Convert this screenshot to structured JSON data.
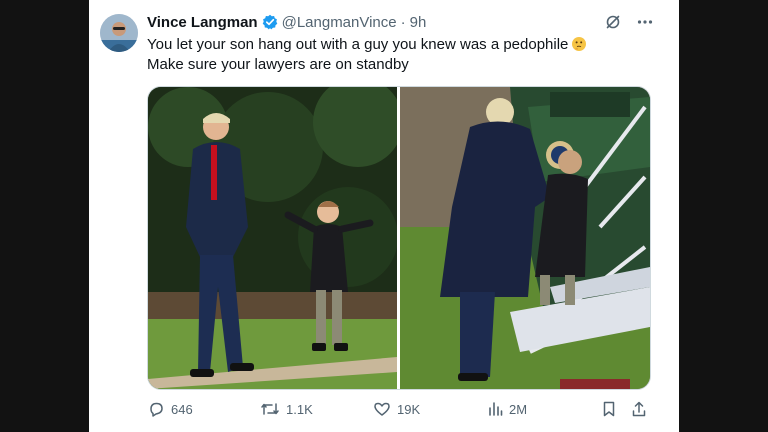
{
  "tweet": {
    "display_name": "Vince Langman",
    "handle": "@LangmanVince",
    "separator": "·",
    "time": "9h",
    "text_line1": "You let your son hang out with a guy you knew was a pedophile",
    "text_line2": "Make sure your lawyers are on standby",
    "emoji": "thinking-face"
  },
  "header_icons": [
    "grok-icon",
    "more-icon"
  ],
  "media": [
    {
      "alt_name": "photo-left",
      "description_icon": "photo"
    },
    {
      "alt_name": "photo-right",
      "description_icon": "photo"
    }
  ],
  "actions": {
    "replies": "646",
    "reposts": "1.1K",
    "likes": "19K",
    "views": "2M"
  },
  "colors": {
    "background": "#121212",
    "card": "#ffffff",
    "text": "#0f1419",
    "secondary": "#536471",
    "verified": "#1d9bf0"
  }
}
